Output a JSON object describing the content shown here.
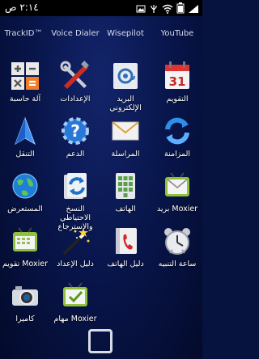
{
  "status_bar": {
    "time": "٢:١٤ ص",
    "icons": [
      "signal-icon",
      "battery-icon",
      "wifi-icon",
      "usb-icon",
      "image-icon"
    ]
  },
  "top_row": [
    "TrackID™",
    "Voice Dialer",
    "Wisepilot",
    "YouTube"
  ],
  "apps": [
    {
      "label": "آلة حاسبة",
      "icon": "calculator-icon"
    },
    {
      "label": "الإعدادات",
      "icon": "settings-icon"
    },
    {
      "label": "البريد الإلكتروني",
      "icon": "email-icon"
    },
    {
      "label": "التقويم",
      "icon": "calendar-icon",
      "icon_text": "31"
    },
    {
      "label": "التنقل",
      "icon": "navigation-icon"
    },
    {
      "label": "الدعم",
      "icon": "support-icon"
    },
    {
      "label": "المراسلة",
      "icon": "messaging-icon"
    },
    {
      "label": "المزامنة",
      "icon": "sync-icon"
    },
    {
      "label": "المستعرض",
      "icon": "browser-icon"
    },
    {
      "label": "النسخ الاحتياطي والاسترجاع",
      "icon": "backup-icon"
    },
    {
      "label": "الهاتف",
      "icon": "phone-dialer-icon"
    },
    {
      "label": "بريد Moxier",
      "icon": "moxier-mail-icon"
    },
    {
      "label": "تقويم Moxier",
      "icon": "moxier-calendar-icon"
    },
    {
      "label": "دليل الإعداد",
      "icon": "setup-guide-icon"
    },
    {
      "label": "دليل الهاتف",
      "icon": "phonebook-icon"
    },
    {
      "label": "ساعة التنبيه",
      "icon": "alarm-clock-icon"
    },
    {
      "label": "كاميرا",
      "icon": "camera-icon"
    },
    {
      "label": "مهام Moxier",
      "icon": "moxier-tasks-icon"
    }
  ],
  "home_button": "home-button"
}
